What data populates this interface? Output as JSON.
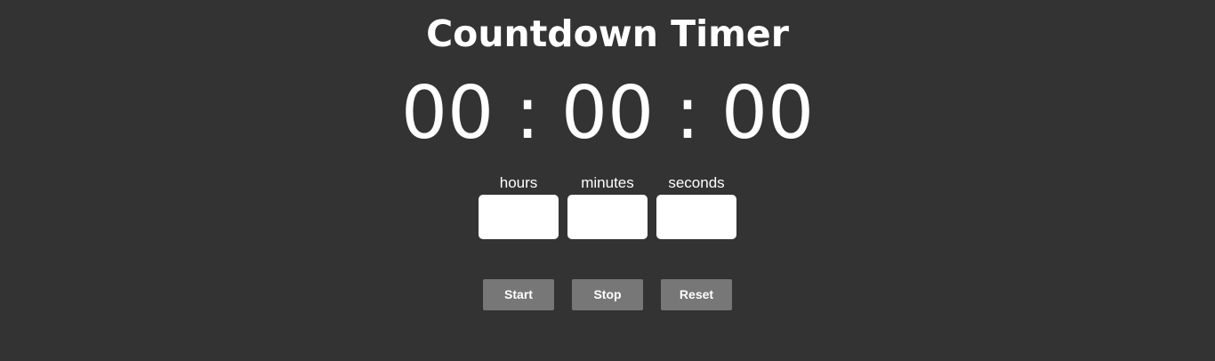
{
  "title": "Countdown Timer",
  "display": {
    "hours": "00",
    "minutes": "00",
    "seconds": "00",
    "separator": ":"
  },
  "fields": {
    "hours": {
      "label": "hours",
      "value": "",
      "placeholder": ""
    },
    "minutes": {
      "label": "minutes",
      "value": "",
      "placeholder": ""
    },
    "seconds": {
      "label": "seconds",
      "value": "",
      "placeholder": ""
    }
  },
  "buttons": {
    "start": "Start",
    "stop": "Stop",
    "reset": "Reset"
  },
  "colors": {
    "background": "#333333",
    "text": "#ffffff",
    "button": "#777777",
    "input": "#ffffff"
  }
}
